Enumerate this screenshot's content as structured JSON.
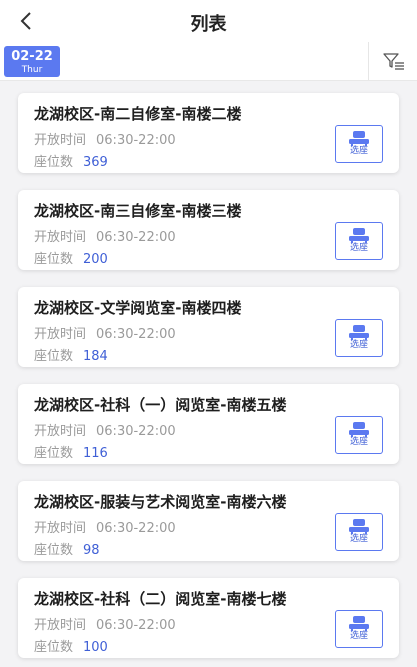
{
  "header": {
    "title": "列表",
    "back_icon": "chevron-left-icon"
  },
  "date_selector": {
    "date": "02-22",
    "weekday": "Thur",
    "accent": "#5b79f0"
  },
  "filter": {
    "icon": "filter-icon"
  },
  "rooms": [
    {
      "name": "龙湖校区-南二自修室-南楼二楼",
      "hours_label": "开放时间",
      "hours": "06:30-22:00",
      "seats_label": "座位数",
      "seats": "369",
      "action": "选座"
    },
    {
      "name": "龙湖校区-南三自修室-南楼三楼",
      "hours_label": "开放时间",
      "hours": "06:30-22:00",
      "seats_label": "座位数",
      "seats": "200",
      "action": "选座"
    },
    {
      "name": "龙湖校区-文学阅览室-南楼四楼",
      "hours_label": "开放时间",
      "hours": "06:30-22:00",
      "seats_label": "座位数",
      "seats": "184",
      "action": "选座"
    },
    {
      "name": "龙湖校区-社科（一）阅览室-南楼五楼",
      "hours_label": "开放时间",
      "hours": "06:30-22:00",
      "seats_label": "座位数",
      "seats": "116",
      "action": "选座"
    },
    {
      "name": "龙湖校区-服装与艺术阅览室-南楼六楼",
      "hours_label": "开放时间",
      "hours": "06:30-22:00",
      "seats_label": "座位数",
      "seats": "98",
      "action": "选座"
    },
    {
      "name": "龙湖校区-社科（二）阅览室-南楼七楼",
      "hours_label": "开放时间",
      "hours": "06:30-22:00",
      "seats_label": "座位数",
      "seats": "100",
      "action": "选座"
    }
  ]
}
